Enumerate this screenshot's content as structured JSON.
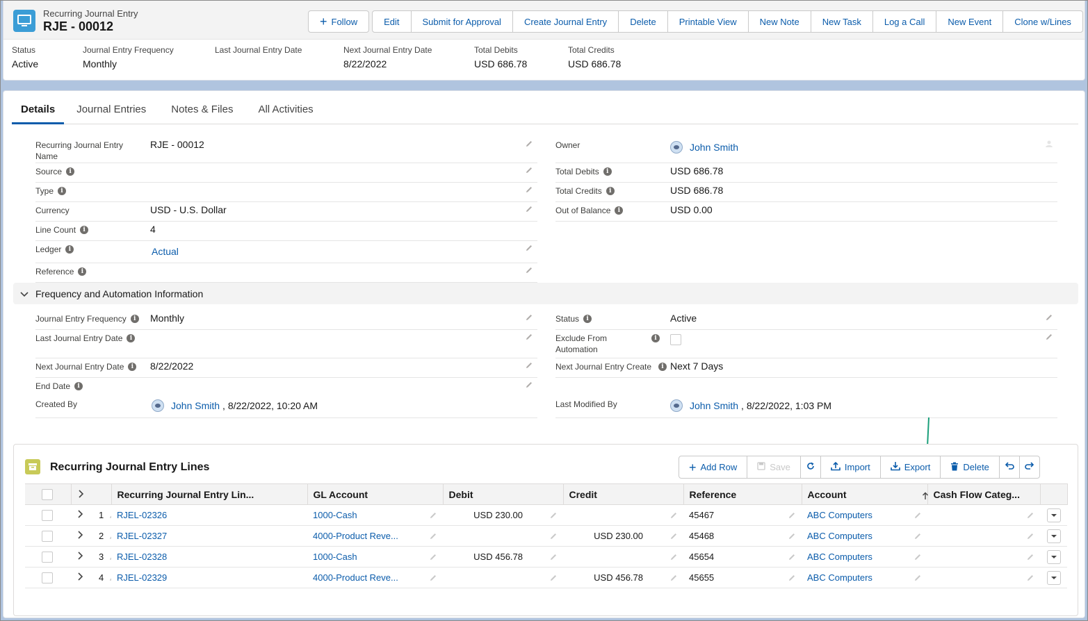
{
  "header": {
    "object_type": "Recurring Journal Entry",
    "record_name": "RJE - 00012",
    "actions": {
      "follow": "Follow",
      "edit": "Edit",
      "submit": "Submit for Approval",
      "create_je": "Create Journal Entry",
      "delete": "Delete",
      "printable": "Printable View",
      "new_note": "New Note",
      "new_task": "New Task",
      "log_call": "Log a Call",
      "new_event": "New Event",
      "clone": "Clone w/Lines"
    },
    "highlights": [
      {
        "label": "Status",
        "value": "Active"
      },
      {
        "label": "Journal Entry Frequency",
        "value": "Monthly"
      },
      {
        "label": "Last Journal Entry Date",
        "value": ""
      },
      {
        "label": "Next Journal Entry Date",
        "value": "8/22/2022"
      },
      {
        "label": "Total Debits",
        "value": "USD 686.78"
      },
      {
        "label": "Total Credits",
        "value": "USD 686.78"
      }
    ]
  },
  "tabs": [
    "Details",
    "Journal Entries",
    "Notes & Files",
    "All Activities"
  ],
  "details": {
    "left": [
      {
        "label": "Recurring Journal Entry Name",
        "value": ""
      },
      {
        "label": "Source",
        "value": ""
      },
      {
        "label": "Type",
        "value": ""
      },
      {
        "label": "Currency",
        "value": "USD - U.S. Dollar"
      },
      {
        "label": "Line Count",
        "value": "4"
      },
      {
        "label": "Ledger",
        "value": "Actual"
      },
      {
        "label": "Reference",
        "value": ""
      }
    ],
    "name_value": "RJE - 00012",
    "right": [
      {
        "label": "Owner",
        "value": "John Smith"
      },
      {
        "label": "Total Debits",
        "value": "USD 686.78"
      },
      {
        "label": "Total Credits",
        "value": "USD 686.78"
      },
      {
        "label": "Out of Balance",
        "value": "USD 0.00"
      }
    ]
  },
  "freq_section": {
    "title": "Frequency and Automation Information",
    "left": [
      {
        "label": "Journal Entry Frequency",
        "value": "Monthly"
      },
      {
        "label": "Last Journal Entry Date",
        "value": ""
      },
      {
        "label": "Next Journal Entry Date",
        "value": "8/22/2022"
      },
      {
        "label": "End Date",
        "value": ""
      },
      {
        "label": "Created By",
        "user": "John Smith",
        "value": ", 8/22/2022, 10:20 AM"
      }
    ],
    "right": [
      {
        "label": "Status",
        "value": "Active"
      },
      {
        "label": "Exclude From Automation",
        "value": ""
      },
      {
        "label": "Next Journal Entry Create",
        "value": "Next 7 Days"
      },
      {
        "label": "Last Modified By",
        "user": "John Smith",
        "value": ", 8/22/2022, 1:03 PM"
      }
    ]
  },
  "lines": {
    "title": "Recurring Journal Entry Lines",
    "actions": {
      "add_row": "Add Row",
      "save": "Save",
      "import": "Import",
      "export": "Export",
      "delete": "Delete"
    },
    "columns": [
      "Recurring Journal Entry Lin...",
      "GL Account",
      "Debit",
      "Credit",
      "Reference",
      "Account",
      "Cash Flow Categ..."
    ],
    "rows": [
      {
        "n": "1",
        "name": "RJEL-02326",
        "gl": "1000-Cash",
        "debit": "USD 230.00",
        "credit": "",
        "ref": "45467",
        "account": "ABC Computers"
      },
      {
        "n": "2",
        "name": "RJEL-02327",
        "gl": "4000-Product Reve...",
        "debit": "",
        "credit": "USD 230.00",
        "ref": "45468",
        "account": "ABC Computers"
      },
      {
        "n": "3",
        "name": "RJEL-02328",
        "gl": "1000-Cash",
        "debit": "USD 456.78",
        "credit": "",
        "ref": "45654",
        "account": "ABC Computers"
      },
      {
        "n": "4",
        "name": "RJEL-02329",
        "gl": "4000-Product Reve...",
        "debit": "",
        "credit": "USD 456.78",
        "ref": "45655",
        "account": "ABC Computers"
      }
    ]
  },
  "colors": {
    "link": "#0b5cab",
    "brand_icon": "#3b9dd6",
    "arrow": "#1a9f7a"
  }
}
